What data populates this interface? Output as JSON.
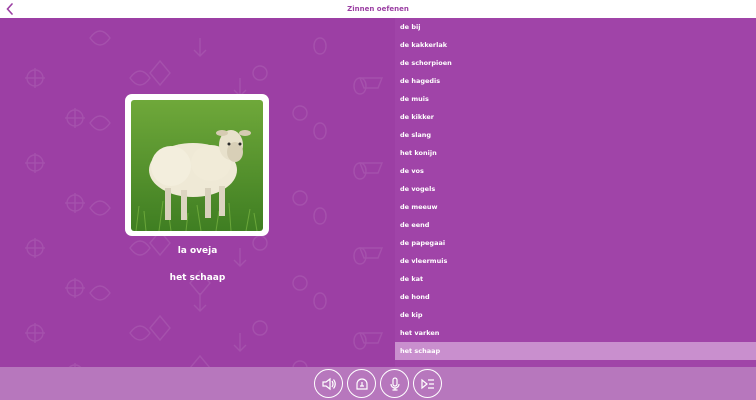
{
  "header": {
    "title": "Zinnen oefenen",
    "back_icon": "chevron-left-icon"
  },
  "card": {
    "image": "sheep-photo",
    "foreign_word": "la oveja",
    "native_word": "het schaap"
  },
  "list": {
    "items": [
      {
        "label": "de bij"
      },
      {
        "label": "de kakkerlak"
      },
      {
        "label": "de schorpioen"
      },
      {
        "label": "de hagedis"
      },
      {
        "label": "de muis"
      },
      {
        "label": "de kikker"
      },
      {
        "label": "de slang"
      },
      {
        "label": "het konijn"
      },
      {
        "label": "de vos"
      },
      {
        "label": "de vogels"
      },
      {
        "label": "de meeuw"
      },
      {
        "label": "de eend"
      },
      {
        "label": "de papegaai"
      },
      {
        "label": "de vleermuis"
      },
      {
        "label": "de kat"
      },
      {
        "label": "de hond"
      },
      {
        "label": "de kip"
      },
      {
        "label": "het varken"
      },
      {
        "label": "het schaap",
        "selected": true
      }
    ]
  },
  "controls": [
    {
      "name": "speaker-icon"
    },
    {
      "name": "slow-audio-icon"
    },
    {
      "name": "microphone-icon"
    },
    {
      "name": "play-list-icon"
    }
  ],
  "colors": {
    "primary": "#9b3fa3",
    "selected": "#c98fce",
    "bottom": "#b777bd"
  }
}
